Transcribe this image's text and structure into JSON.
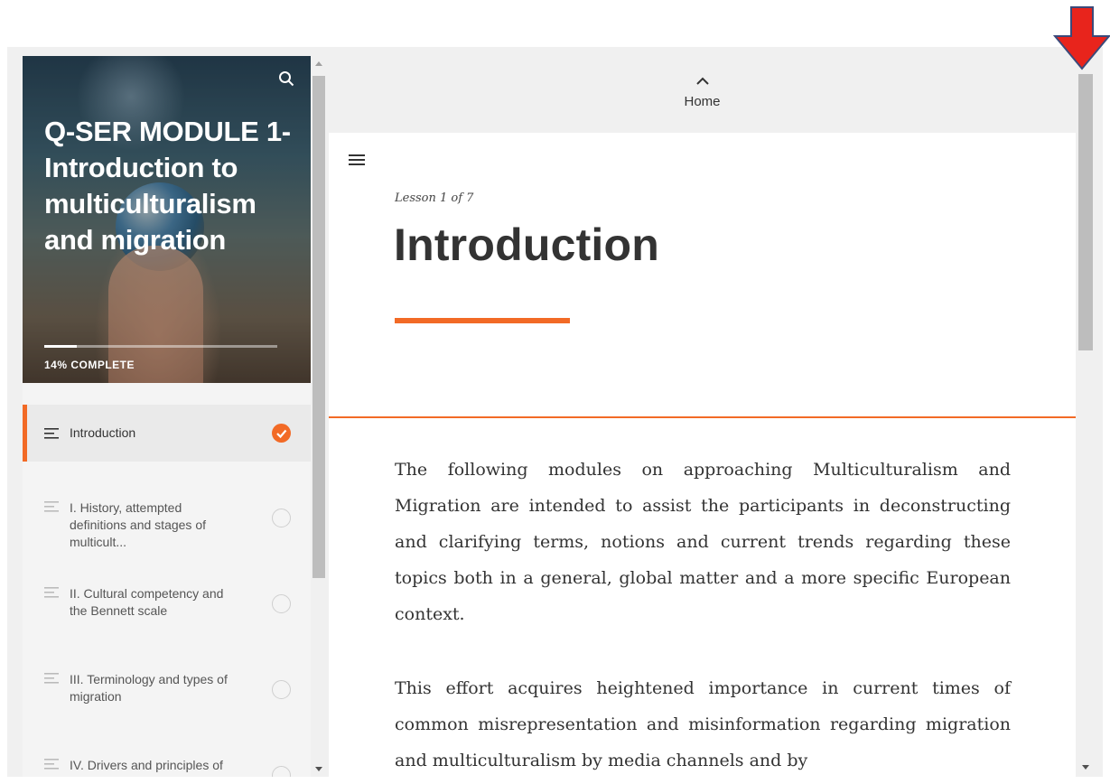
{
  "course": {
    "title": "Q-SER MODULE 1- Introduction to multiculturalism and migration",
    "progress_label": "14% COMPLETE",
    "progress_fraction": 0.14
  },
  "lessons": [
    {
      "label": "Introduction",
      "active": true,
      "complete": true
    },
    {
      "label": "I. History, attempted definitions and stages of multicult...",
      "active": false,
      "complete": false
    },
    {
      "label": "II. Cultural competency and the Bennett scale",
      "active": false,
      "complete": false
    },
    {
      "label": "III. Terminology and types of migration",
      "active": false,
      "complete": false
    },
    {
      "label": "IV. Drivers and principles of",
      "active": false,
      "complete": false
    }
  ],
  "topbar": {
    "home_label": "Home"
  },
  "lesson": {
    "counter": "Lesson 1 of 7",
    "title": "Introduction",
    "paragraphs": [
      "The following modules on approaching Multiculturalism and Migration are intended to assist the participants in deconstructing and clarifying terms, notions and current trends regarding these topics both in a general, global matter and a more specific European context.",
      "This effort acquires heightened importance in current times of common misrepresentation and misinformation regarding migration and multiculturalism by media channels and by"
    ]
  },
  "icons": {
    "search": "search-icon",
    "menu": "menu-icon",
    "home": "chevron-up-icon",
    "lesson": "lesson-lines-icon",
    "complete": "checkmark-icon",
    "annotation": "red-arrow-down-icon"
  },
  "colors": {
    "accent": "#f26a26",
    "annotation": "#e8241c"
  }
}
